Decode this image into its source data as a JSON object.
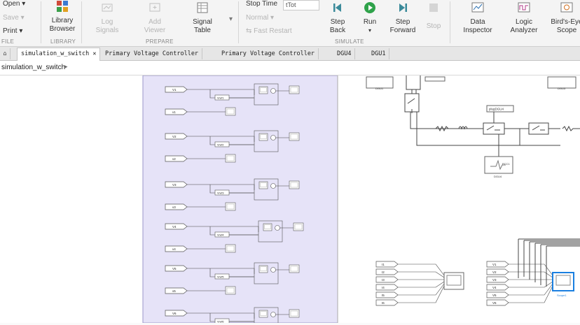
{
  "ribbon": {
    "file": {
      "open": "Open",
      "save": "Save",
      "print": "Print",
      "section": "FILE"
    },
    "library": {
      "browser": "Library\nBrowser",
      "section": "LIBRARY"
    },
    "prepare": {
      "log_signals": "Log\nSignals",
      "add_viewer": "Add\nViewer",
      "signal_table": "Signal\nTable",
      "section": "PREPARE"
    },
    "simulate": {
      "stop_time_label": "Stop Time",
      "stop_time_value": "tTot",
      "mode": "Normal",
      "fast_restart": "Fast Restart",
      "step_back": "Step\nBack",
      "run": "Run",
      "step_forward": "Step\nForward",
      "stop": "Stop",
      "section": "SIMULATE"
    },
    "review": {
      "data_inspector": "Data\nInspector",
      "logic_analyzer": "Logic\nAnalyzer",
      "birds_eye": "Bird's-Eye\nScope"
    }
  },
  "tabs": [
    {
      "label": "simulation_w_switch",
      "active": true
    },
    {
      "label": "Primary Voltage Controller",
      "active": false
    },
    {
      "label": "Primary Voltage Controller",
      "active": false
    },
    {
      "label": "DGU4",
      "active": false
    },
    {
      "label": "DGU1",
      "active": false
    }
  ],
  "breadcrumb": {
    "path": "simulation_w_switch"
  },
  "diagram": {
    "left_ports": [
      "V1",
      "v1",
      "V2",
      "v2",
      "V3",
      "v3",
      "V4",
      "v4",
      "V5",
      "v5",
      "V6"
    ],
    "ref_labels": [
      "Vref1",
      "Vref2",
      "Vref3",
      "Vref4",
      "Vref5",
      "Vref6"
    ],
    "top_blocks": [
      "DGU1",
      "DGU3"
    ],
    "pcc_label": "PCC1",
    "dgu_label": "DGU4",
    "plug_label": "plugDGU4",
    "bottom_left_ports": [
      "I1",
      "I2",
      "I3",
      "I4",
      "I5",
      "I6"
    ],
    "bottom_right_ports": [
      "V1",
      "V2",
      "V3",
      "V4",
      "V5",
      "V6"
    ],
    "scope_caption": "Scope1",
    "colors": {
      "subsystem": "#e6e3f8",
      "scope_sel": "#1a7fe0"
    }
  }
}
